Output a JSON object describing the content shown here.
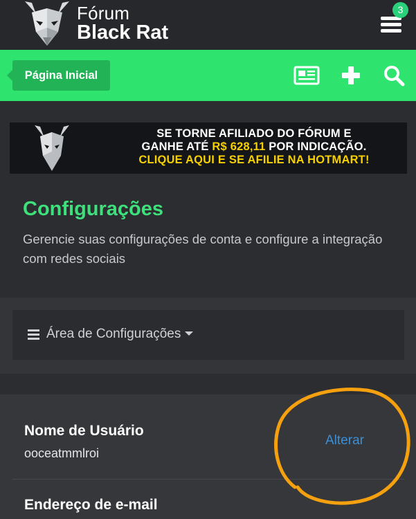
{
  "header": {
    "logo_line1": "Fórum",
    "logo_line2": "Black Rat",
    "notification_count": "3",
    "menu_icon": "hamburger-icon"
  },
  "nav": {
    "home_label": "Página Inicial",
    "icons": [
      "newspaper-icon",
      "plus-icon",
      "search-icon"
    ]
  },
  "banner": {
    "line1": "SE TORNE AFILIADO DO FÓRUM E",
    "line2_pre": "GANHE ATÉ ",
    "line2_amount": "R$ 628,11",
    "line2_post": " POR INDICAÇÃO.",
    "line3": "CLIQUE AQUI E SE AFILIE NA HOTMART!"
  },
  "page": {
    "title": "Configurações",
    "description": "Gerencie suas configurações de conta e configure a integração com redes sociais"
  },
  "settings_menu": {
    "label": "Área de Configurações"
  },
  "settings": {
    "username_label": "Nome de Usuário",
    "username_value": "ooceatmmlroi",
    "change_link": "Alterar",
    "email_label": "Endereço de e-mail"
  },
  "colors": {
    "accent_green": "#2ee46e",
    "title_green": "#3ee07c",
    "link_blue": "#3a8fd8",
    "highlight_orange": "#f5a00f",
    "banner_yellow": "#f6d000"
  }
}
